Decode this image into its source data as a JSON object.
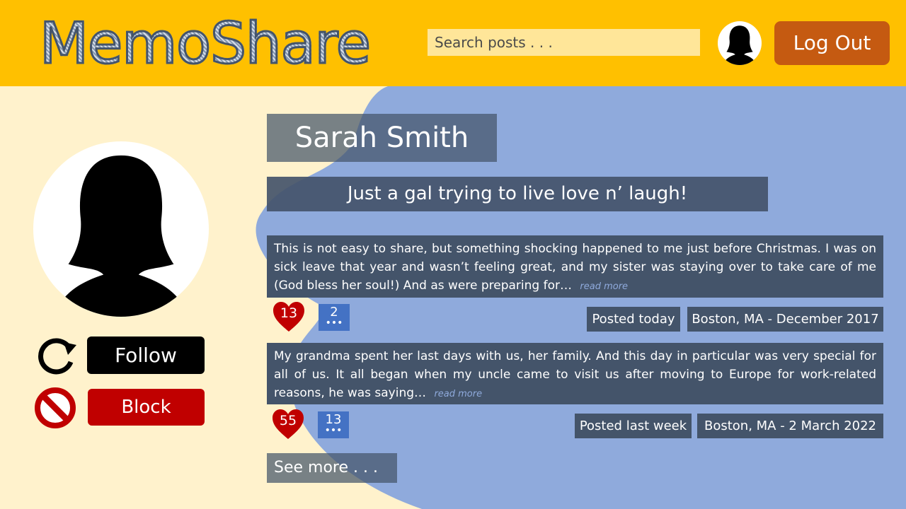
{
  "header": {
    "logo": "MemoShare",
    "search_placeholder": "Search posts . . .",
    "logout_label": "Log Out"
  },
  "profile": {
    "name": "Sarah Smith",
    "bio": "Just a gal trying to live love n’ laugh!",
    "follow_label": "Follow",
    "block_label": "Block"
  },
  "posts": [
    {
      "text": "This is not easy to share, but something shocking happened to me just before Christmas. I was on sick leave that year and wasn’t feeling great, and my sister was staying over to take care of me (God bless her soul!) And as were preparing for…",
      "read_more": "read more",
      "likes": "13",
      "comments": "2",
      "posted": "Posted today",
      "location_date": "Boston, MA - December  2017"
    },
    {
      "text": "My grandma spent her last days with us, her family. And this day in particular was very special for all of us. It all began when my uncle came to visit us after moving to Europe for work-related reasons, he was saying…",
      "read_more": "read more",
      "likes": "55",
      "comments": "13",
      "posted": "Posted last week",
      "location_date": "Boston, MA - 2 March 2022"
    }
  ],
  "see_more_label": "See more . . .",
  "colors": {
    "header_bg": "#ffc000",
    "page_bg": "#fff2cc",
    "blob": "#8faadc",
    "panel": "#44546a",
    "logout": "#c55a11",
    "block": "#c00000",
    "heart": "#c00000",
    "comment": "#4472c4"
  },
  "icons": [
    "person-silhouette-icon",
    "refresh-icon",
    "no-entry-icon",
    "heart-icon",
    "comment-icon"
  ]
}
